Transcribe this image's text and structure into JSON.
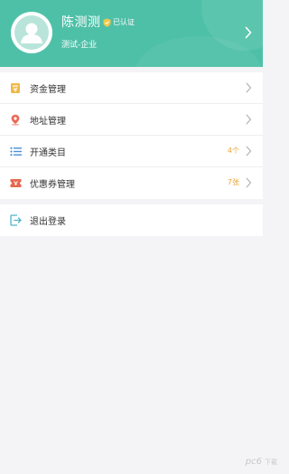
{
  "colors": {
    "header": "#4fc0a8",
    "accent_count": "#e9a437",
    "background": "#f4f4f6"
  },
  "profile": {
    "name": "陈测测",
    "verified_label": "已认证",
    "subtitle": "测试-企业",
    "avatar_icon": "user-avatar-icon",
    "chevron_icon": "chevron-right-icon"
  },
  "menu": {
    "items": [
      {
        "label": "资金管理",
        "icon": "wallet-icon",
        "count": ""
      },
      {
        "label": "地址管理",
        "icon": "location-pin-icon",
        "count": ""
      },
      {
        "label": "开通类目",
        "icon": "list-icon",
        "count": "4个"
      },
      {
        "label": "优惠券管理",
        "icon": "coupon-icon",
        "count": "7张"
      }
    ],
    "logout": {
      "label": "退出登录",
      "icon": "logout-icon"
    }
  },
  "watermark": {
    "text": "pc6",
    "suffix": "下载"
  }
}
